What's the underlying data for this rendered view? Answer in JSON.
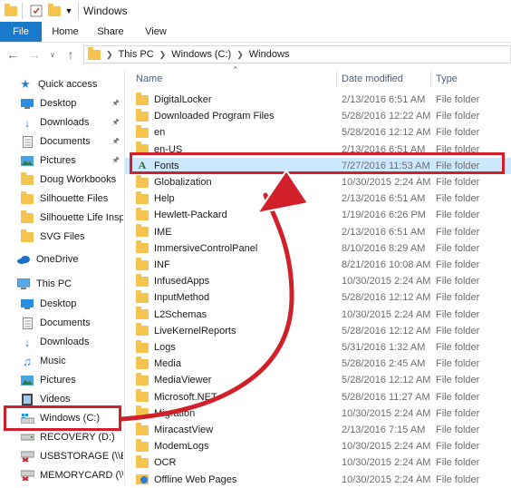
{
  "window": {
    "title": "Windows"
  },
  "ribbon": {
    "tabs": [
      "File",
      "Home",
      "Share",
      "View"
    ]
  },
  "address": {
    "path": [
      "This PC",
      "Windows (C:)",
      "Windows"
    ]
  },
  "columns": {
    "name": "Name",
    "date": "Date modified",
    "type": "Type"
  },
  "sidebar": {
    "quick_access": "Quick access",
    "quick_items": [
      "Desktop",
      "Downloads",
      "Documents",
      "Pictures",
      "Doug Workbooks",
      "Silhouette Files",
      "Silhouette Life Inspi",
      "SVG Files"
    ],
    "onedrive": "OneDrive",
    "this_pc": "This PC",
    "pc_items": [
      "Desktop",
      "Documents",
      "Downloads",
      "Music",
      "Pictures",
      "Videos",
      "Windows (C:)",
      "RECOVERY (D:)",
      "USBSTORAGE (\\\\EPS",
      "MEMORYCARD (\\\\E"
    ]
  },
  "files": [
    {
      "name": "DigitalLocker",
      "date": "2/13/2016 6:51 AM",
      "type": "File folder"
    },
    {
      "name": "Downloaded Program Files",
      "date": "5/28/2016 12:22 AM",
      "type": "File folder"
    },
    {
      "name": "en",
      "date": "5/28/2016 12:12 AM",
      "type": "File folder"
    },
    {
      "name": "en-US",
      "date": "2/13/2016 6:51 AM",
      "type": "File folder"
    },
    {
      "name": "Fonts",
      "date": "7/27/2016 11:53 AM",
      "type": "File folder"
    },
    {
      "name": "Globalization",
      "date": "10/30/2015 2:24 AM",
      "type": "File folder"
    },
    {
      "name": "Help",
      "date": "2/13/2016 6:51 AM",
      "type": "File folder"
    },
    {
      "name": "Hewlett-Packard",
      "date": "1/19/2016 6:26 PM",
      "type": "File folder"
    },
    {
      "name": "IME",
      "date": "2/13/2016 6:51 AM",
      "type": "File folder"
    },
    {
      "name": "ImmersiveControlPanel",
      "date": "8/10/2016 8:29 AM",
      "type": "File folder"
    },
    {
      "name": "INF",
      "date": "8/21/2016 10:08 AM",
      "type": "File folder"
    },
    {
      "name": "InfusedApps",
      "date": "10/30/2015 2:24 AM",
      "type": "File folder"
    },
    {
      "name": "InputMethod",
      "date": "5/28/2016 12:12 AM",
      "type": "File folder"
    },
    {
      "name": "L2Schemas",
      "date": "10/30/2015 2:24 AM",
      "type": "File folder"
    },
    {
      "name": "LiveKernelReports",
      "date": "5/28/2016 12:12 AM",
      "type": "File folder"
    },
    {
      "name": "Logs",
      "date": "5/31/2016 1:32 AM",
      "type": "File folder"
    },
    {
      "name": "Media",
      "date": "5/28/2016 2:45 AM",
      "type": "File folder"
    },
    {
      "name": "MediaViewer",
      "date": "5/28/2016 12:12 AM",
      "type": "File folder"
    },
    {
      "name": "Microsoft.NET",
      "date": "5/28/2016 11:27 AM",
      "type": "File folder"
    },
    {
      "name": "Migration",
      "date": "10/30/2015 2:24 AM",
      "type": "File folder"
    },
    {
      "name": "MiracastView",
      "date": "2/13/2016 7:15 AM",
      "type": "File folder"
    },
    {
      "name": "ModemLogs",
      "date": "10/30/2015 2:24 AM",
      "type": "File folder"
    },
    {
      "name": "OCR",
      "date": "10/30/2015 2:24 AM",
      "type": "File folder"
    },
    {
      "name": "Offline Web Pages",
      "date": "10/30/2015 2:24 AM",
      "type": "File folder"
    }
  ],
  "colors": {
    "accent": "#1979ca",
    "highlight": "#d1202a",
    "selection": "#cce8ff",
    "folder": "#f4c44f"
  }
}
